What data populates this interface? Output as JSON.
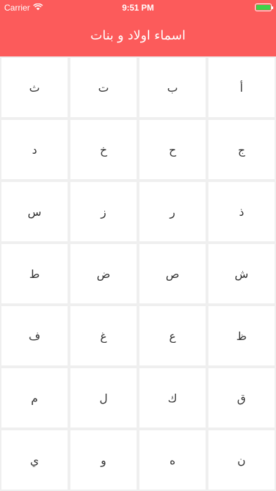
{
  "status_bar": {
    "carrier": "Carrier",
    "time": "9:51 PM",
    "wifi_icon": "wifi-icon",
    "battery_icon": "battery-icon"
  },
  "nav": {
    "title": "اسماء اولاد و بنات"
  },
  "colors": {
    "header": "#fc5b5b",
    "battery": "#3fd14a",
    "cell_background": "#ffffff",
    "grid_background": "#efefef"
  },
  "letters": [
    "أ",
    "ب",
    "ت",
    "ث",
    "ج",
    "ح",
    "خ",
    "د",
    "ذ",
    "ر",
    "ز",
    "س",
    "ش",
    "ص",
    "ض",
    "ط",
    "ظ",
    "ع",
    "غ",
    "ف",
    "ق",
    "ك",
    "ل",
    "م",
    "ن",
    "ه",
    "و",
    "ي"
  ]
}
